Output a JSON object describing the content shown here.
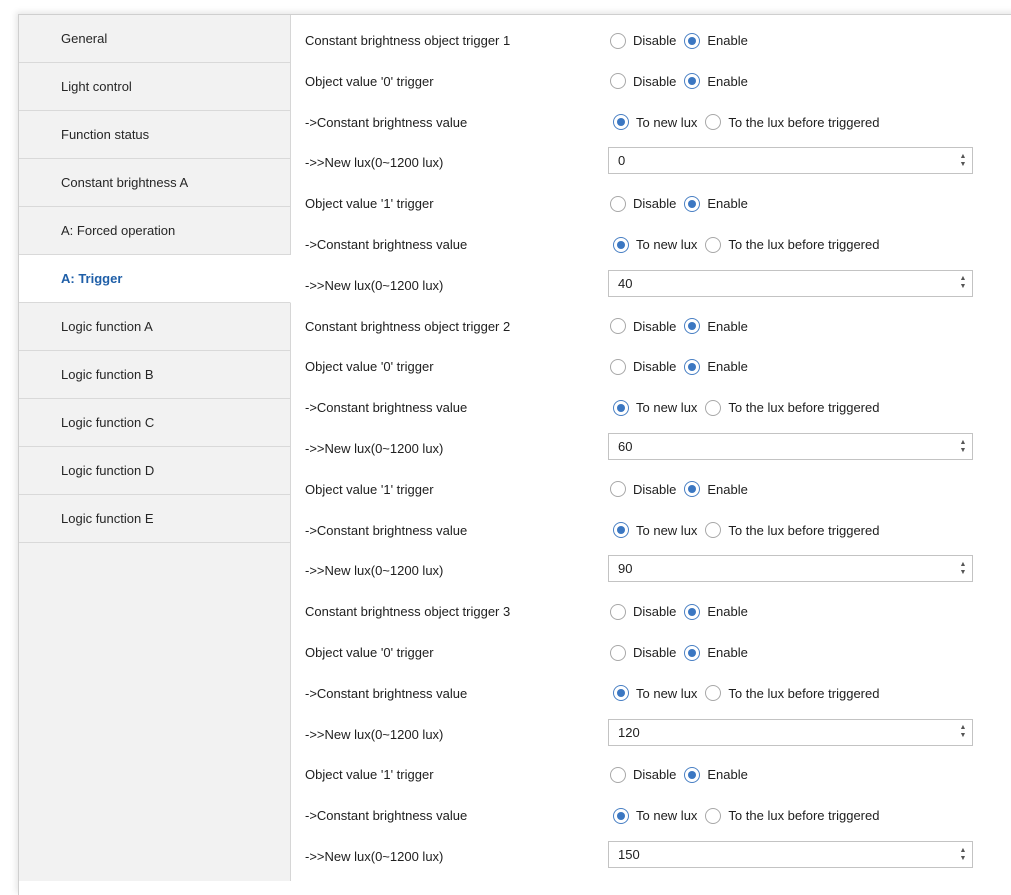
{
  "sidebar": {
    "items": [
      {
        "label": "General",
        "active": false
      },
      {
        "label": "Light control",
        "active": false
      },
      {
        "label": "Function status",
        "active": false
      },
      {
        "label": "Constant brightness A",
        "active": false
      },
      {
        "label": "A: Forced operation",
        "active": false
      },
      {
        "label": "A: Trigger",
        "active": true
      },
      {
        "label": "Logic function A",
        "active": false
      },
      {
        "label": "Logic function B",
        "active": false
      },
      {
        "label": "Logic function C",
        "active": false
      },
      {
        "label": "Logic function D",
        "active": false
      },
      {
        "label": "Logic function E",
        "active": false
      }
    ]
  },
  "options": {
    "disable": "Disable",
    "enable": "Enable",
    "to_new_lux": "To new lux",
    "to_lux_before": "To the lux before triggered"
  },
  "main": {
    "rows": [
      {
        "label": "Constant brightness object trigger  1",
        "type": "enable",
        "selected": "enable"
      },
      {
        "label": "Object value '0' trigger",
        "type": "enable",
        "selected": "enable"
      },
      {
        "label": "->Constant brightness value",
        "type": "lux",
        "selected": "new"
      },
      {
        "label": "->>New lux(0~1200 lux)",
        "type": "spin",
        "value": "0"
      },
      {
        "label": "Object value '1' trigger",
        "type": "enable",
        "selected": "enable"
      },
      {
        "label": "->Constant brightness value",
        "type": "lux",
        "selected": "new"
      },
      {
        "label": "->>New lux(0~1200 lux)",
        "type": "spin",
        "value": "40"
      },
      {
        "label": "Constant brightness object trigger  2",
        "type": "enable",
        "selected": "enable"
      },
      {
        "label": "Object value '0' trigger",
        "type": "enable",
        "selected": "enable"
      },
      {
        "label": "->Constant brightness value",
        "type": "lux",
        "selected": "new"
      },
      {
        "label": "->>New lux(0~1200 lux)",
        "type": "spin",
        "value": "60"
      },
      {
        "label": "Object value '1' trigger",
        "type": "enable",
        "selected": "enable"
      },
      {
        "label": "->Constant brightness value",
        "type": "lux",
        "selected": "new"
      },
      {
        "label": "->>New lux(0~1200 lux)",
        "type": "spin",
        "value": "90"
      },
      {
        "label": "Constant brightness object trigger  3",
        "type": "enable",
        "selected": "enable"
      },
      {
        "label": "Object value '0' trigger",
        "type": "enable",
        "selected": "enable"
      },
      {
        "label": "->Constant brightness value",
        "type": "lux",
        "selected": "new"
      },
      {
        "label": "->>New lux(0~1200 lux)",
        "type": "spin",
        "value": "120"
      },
      {
        "label": "Object value '1' trigger",
        "type": "enable",
        "selected": "enable"
      },
      {
        "label": "->Constant brightness value",
        "type": "lux",
        "selected": "new"
      },
      {
        "label": "->>New lux(0~1200 lux)",
        "type": "spin",
        "value": "150"
      }
    ]
  }
}
